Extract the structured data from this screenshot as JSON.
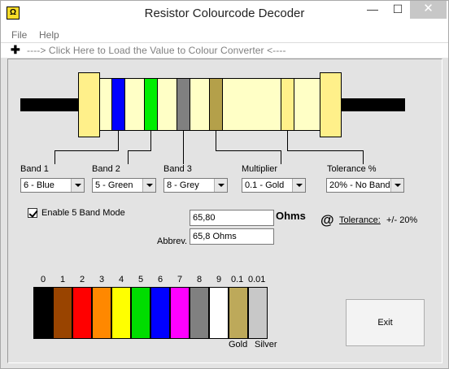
{
  "window": {
    "title": "Resistor Colourcode Decoder",
    "app_icon": "Ω",
    "minimize": "—",
    "maximize": "☐",
    "close": "✕"
  },
  "menu": {
    "file": "File",
    "help": "Help"
  },
  "load_link": {
    "icon": "✚",
    "text": "----> Click Here to Load the Value to Colour Converter <----"
  },
  "resistor": {
    "colors": {
      "band1": "#0000ff",
      "band2": "#00ee00",
      "band3": "#808080",
      "multiplier": "#b4a04a",
      "tolerance": "#fff08a",
      "body": "#ffffc6",
      "cap": "#fff08a"
    }
  },
  "bands": {
    "band1": {
      "label": "Band 1",
      "value": "6 - Blue"
    },
    "band2": {
      "label": "Band 2",
      "value": "5 - Green"
    },
    "band3": {
      "label": "Band 3",
      "value": "8 - Grey"
    },
    "multiplier": {
      "label": "Multiplier",
      "value": "0.1 - Gold"
    },
    "tolerance": {
      "label": "Tolerance %",
      "value": "20% - No Band"
    }
  },
  "five_band": {
    "label": "Enable 5 Band Mode",
    "checked": true
  },
  "result": {
    "value": "65,80",
    "unit": "Ohms",
    "abbrev_label": "Abbrev.",
    "abbrev_value": "65,8 Ohms",
    "tolerance_icon": "@",
    "tolerance_label": "Tolerance:",
    "tolerance_value": "+/- 20%"
  },
  "chart": {
    "labels": [
      "0",
      "1",
      "2",
      "3",
      "4",
      "5",
      "6",
      "7",
      "8",
      "9",
      "0.1",
      "0.01"
    ],
    "colors": [
      "#000000",
      "#994400",
      "#ff0000",
      "#ff8800",
      "#ffff00",
      "#00dd00",
      "#0000ff",
      "#ff00ff",
      "#808080",
      "#ffffff",
      "#bda95a",
      "#c8c8c8"
    ],
    "bottom_labels": {
      "gold": "Gold",
      "silver": "Silver"
    }
  },
  "exit_button": "Exit"
}
